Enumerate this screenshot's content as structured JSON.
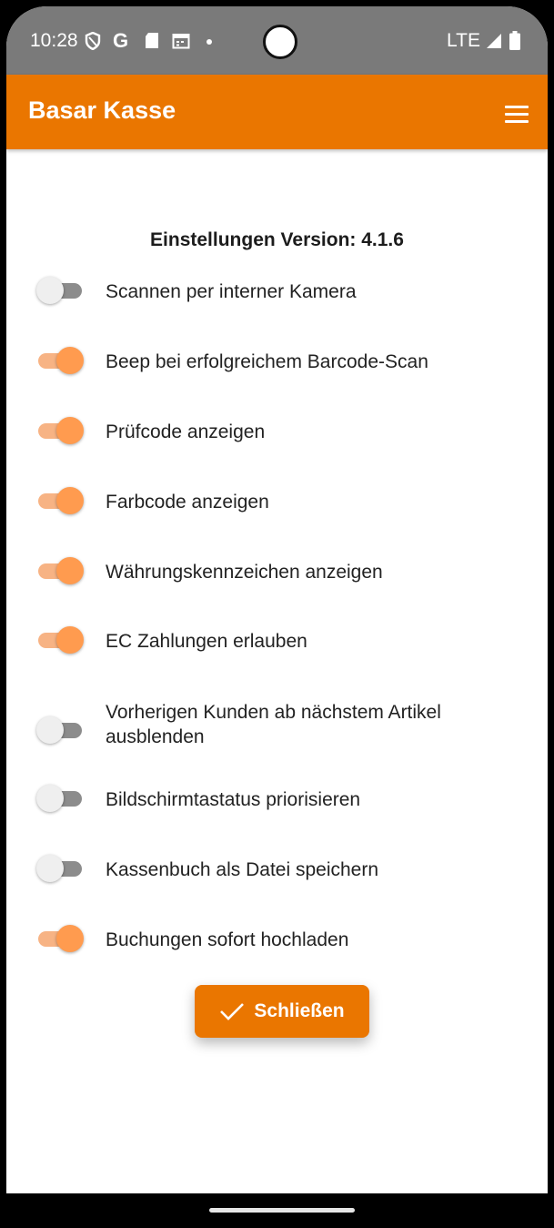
{
  "status_bar": {
    "time": "10:28",
    "network": "LTE",
    "icons": [
      "vpn-shield-icon",
      "google-icon",
      "sd-card-icon",
      "calendar-icon",
      "dot-icon",
      "signal-icon",
      "battery-icon"
    ]
  },
  "app_bar": {
    "title": "Basar Kasse",
    "menu_icon": "hamburger-menu-icon",
    "color": "#ea7600"
  },
  "settings": {
    "title": "Einstellungen Version: 4.1.6",
    "items": [
      {
        "label": "Scannen per interner Kamera",
        "enabled": false
      },
      {
        "label": "Beep bei erfolgreichem Barcode-Scan",
        "enabled": true
      },
      {
        "label": "Prüfcode anzeigen",
        "enabled": true
      },
      {
        "label": "Farbcode anzeigen",
        "enabled": true
      },
      {
        "label": "Währungskennzeichen anzeigen",
        "enabled": true
      },
      {
        "label": "EC Zahlungen erlauben",
        "enabled": true
      },
      {
        "label": "Vorherigen Kunden ab nächstem Artikel ausblenden",
        "enabled": false
      },
      {
        "label": "Bildschirmtastatus priorisieren",
        "enabled": false
      },
      {
        "label": "Kassenbuch als Datei speichern",
        "enabled": false
      },
      {
        "label": "Buchungen sofort hochladen",
        "enabled": true
      }
    ]
  },
  "close_button": {
    "label": "Schließen",
    "icon": "check-icon"
  },
  "colors": {
    "accent": "#ea7600",
    "switch_on_thumb": "#ff9b4f",
    "switch_on_track": "#f7b384",
    "switch_off_thumb": "#efefef",
    "switch_off_track": "#8c8c8c"
  }
}
